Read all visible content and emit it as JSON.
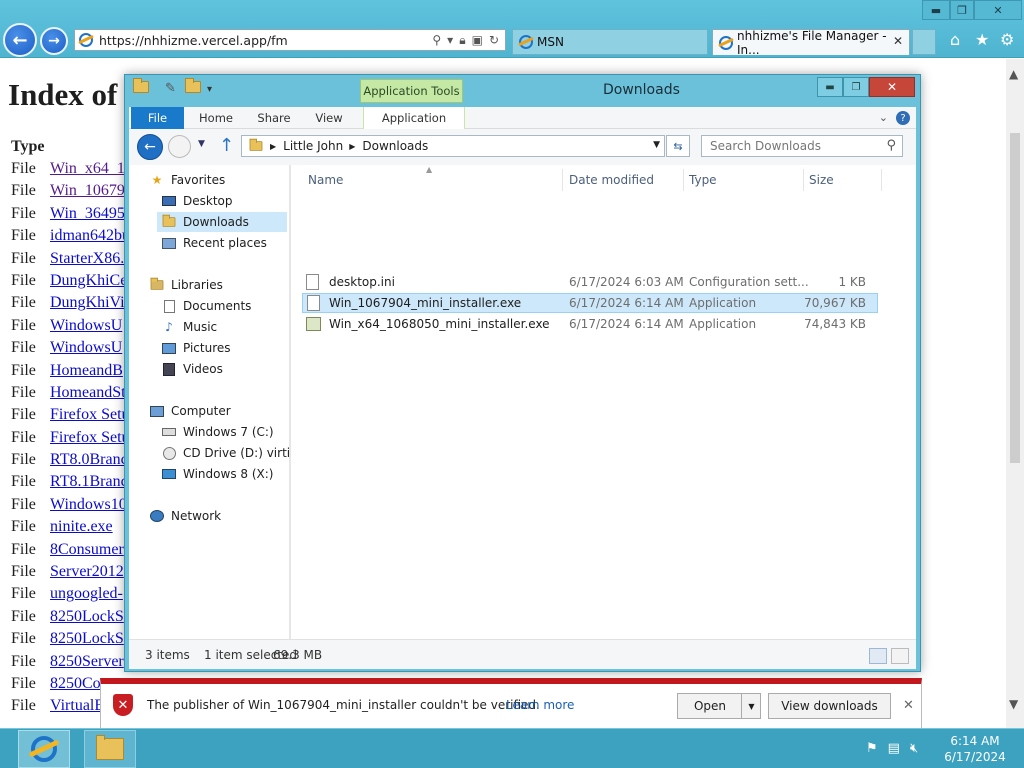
{
  "ie": {
    "address": "https://nhhizme.vercel.app/fm",
    "tabs": [
      {
        "label": "MSN"
      },
      {
        "label": "nhhizme's File Manager - In..."
      }
    ],
    "page": {
      "heading": "Index of",
      "type_header": "Type",
      "rows": [
        {
          "type": "File",
          "name": "Win_x64_1",
          "visited": true
        },
        {
          "type": "File",
          "name": "Win_10679",
          "visited": true
        },
        {
          "type": "File",
          "name": "Win_36495",
          "visited": false
        },
        {
          "type": "File",
          "name": "idman642bu",
          "visited": false
        },
        {
          "type": "File",
          "name": "StarterX86.",
          "visited": false
        },
        {
          "type": "File",
          "name": "DungKhiCe",
          "visited": false
        },
        {
          "type": "File",
          "name": "DungKhiVi",
          "visited": false
        },
        {
          "type": "File",
          "name": "WindowsU",
          "visited": false
        },
        {
          "type": "File",
          "name": "WindowsU",
          "visited": false
        },
        {
          "type": "File",
          "name": "HomeandB",
          "visited": false
        },
        {
          "type": "File",
          "name": "HomeandSt",
          "visited": false
        },
        {
          "type": "File",
          "name": "Firefox Setu",
          "visited": false
        },
        {
          "type": "File",
          "name": "Firefox Setu",
          "visited": false
        },
        {
          "type": "File",
          "name": "RT8.0Branc",
          "visited": false
        },
        {
          "type": "File",
          "name": "RT8.1Branc",
          "visited": false
        },
        {
          "type": "File",
          "name": "Windows10",
          "visited": false
        },
        {
          "type": "File",
          "name": "ninite.exe",
          "visited": false
        },
        {
          "type": "File",
          "name": "8Consumer",
          "visited": false
        },
        {
          "type": "File",
          "name": "Server2012",
          "visited": false
        },
        {
          "type": "File",
          "name": "ungoogled-",
          "visited": false
        },
        {
          "type": "File",
          "name": "8250LockS",
          "visited": false
        },
        {
          "type": "File",
          "name": "8250LockS",
          "visited": false
        },
        {
          "type": "File",
          "name": "8250Server",
          "visited": false
        },
        {
          "type": "File",
          "name": "8250Co",
          "visited": false
        },
        {
          "type": "File",
          "name": "VirtualB",
          "visited": false
        }
      ]
    }
  },
  "explorer": {
    "title": "Downloads",
    "app_tools": "Application Tools",
    "ribbon_tabs": [
      "File",
      "Home",
      "Share",
      "View",
      "Application"
    ],
    "breadcrumb": [
      "Little John",
      "Downloads"
    ],
    "search_placeholder": "Search Downloads",
    "nav": {
      "favorites": "Favorites",
      "desktop": "Desktop",
      "downloads": "Downloads",
      "recent": "Recent places",
      "libraries": "Libraries",
      "documents": "Documents",
      "music": "Music",
      "pictures": "Pictures",
      "videos": "Videos",
      "computer": "Computer",
      "drive_c": "Windows 7 (C:)",
      "drive_d": "CD Drive (D:) virtio-v",
      "drive_x": "Windows 8 (X:)",
      "network": "Network"
    },
    "columns": {
      "name": "Name",
      "date": "Date modified",
      "type": "Type",
      "size": "Size"
    },
    "files": [
      {
        "name": "desktop.ini",
        "date": "6/17/2024 6:03 AM",
        "type": "Configuration sett...",
        "size": "1 KB"
      },
      {
        "name": "Win_1067904_mini_installer.exe",
        "date": "6/17/2024 6:14 AM",
        "type": "Application",
        "size": "70,967 KB"
      },
      {
        "name": "Win_x64_1068050_mini_installer.exe",
        "date": "6/17/2024 6:14 AM",
        "type": "Application",
        "size": "74,843 KB"
      }
    ],
    "status": {
      "count": "3 items",
      "selection": "1 item selected",
      "size": "69.3 MB"
    }
  },
  "notification": {
    "message": "The publisher of Win_1067904_mini_installer couldn't be verified.",
    "learn_more": "Learn more",
    "open": "Open",
    "view_downloads": "View downloads"
  },
  "taskbar": {
    "time": "6:14 AM",
    "date": "6/17/2024"
  }
}
